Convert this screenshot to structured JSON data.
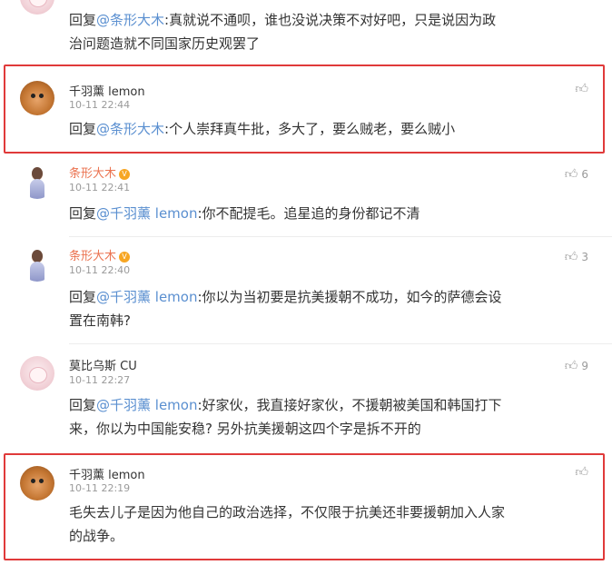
{
  "comments": [
    {
      "reply_prefix": "回复",
      "mention": "@条形大木",
      "text": ":真就说不通呗，谁也没说决策不对好吧，只是说因为政",
      "text2": "治问题造就不同国家历史观罢了"
    },
    {
      "username": "千羽薰 lemon",
      "time": "10-11 22:44",
      "reply_prefix": "回复",
      "mention": "@条形大木",
      "text": ":个人崇拜真牛批，多大了，要么贼老，要么贼小",
      "likes": "",
      "highlighted": true
    },
    {
      "username": "条形大木",
      "time": "10-11 22:41",
      "reply_prefix": "回复",
      "mention": "@千羽薰 lemon",
      "text": ":你不配提毛。追星追的身份都记不清",
      "likes": "6"
    },
    {
      "username": "条形大木",
      "time": "10-11 22:40",
      "reply_prefix": "回复",
      "mention": "@千羽薰 lemon",
      "text": ":你以为当初要是抗美援朝不成功，如今的萨德会设",
      "text2": "置在南韩?",
      "likes": "3"
    },
    {
      "username": "莫比乌斯 CU",
      "time": "10-11 22:27",
      "reply_prefix": "回复",
      "mention": "@千羽薰 lemon",
      "text": ":好家伙，我直接好家伙，不援朝被美国和韩国打下",
      "text2": "来，你以为中国能安稳? 另外抗美援朝这四个字是拆不开的",
      "likes": "9"
    },
    {
      "username": "千羽薰 lemon",
      "time": "10-11 22:19",
      "text": "毛失去儿子是因为他自己的政治选择，不仅限于抗美还非要援朝加入人家",
      "text2": "的战争。",
      "likes": "",
      "highlighted": true
    }
  ],
  "colors": {
    "mention": "#5a8fd0",
    "vip_username": "#eb7350",
    "highlight_border": "#e03a3a",
    "meta": "#9a9a9a"
  },
  "icons": {
    "like": "thumbs-up-icon",
    "vip": "vip-badge-icon"
  }
}
